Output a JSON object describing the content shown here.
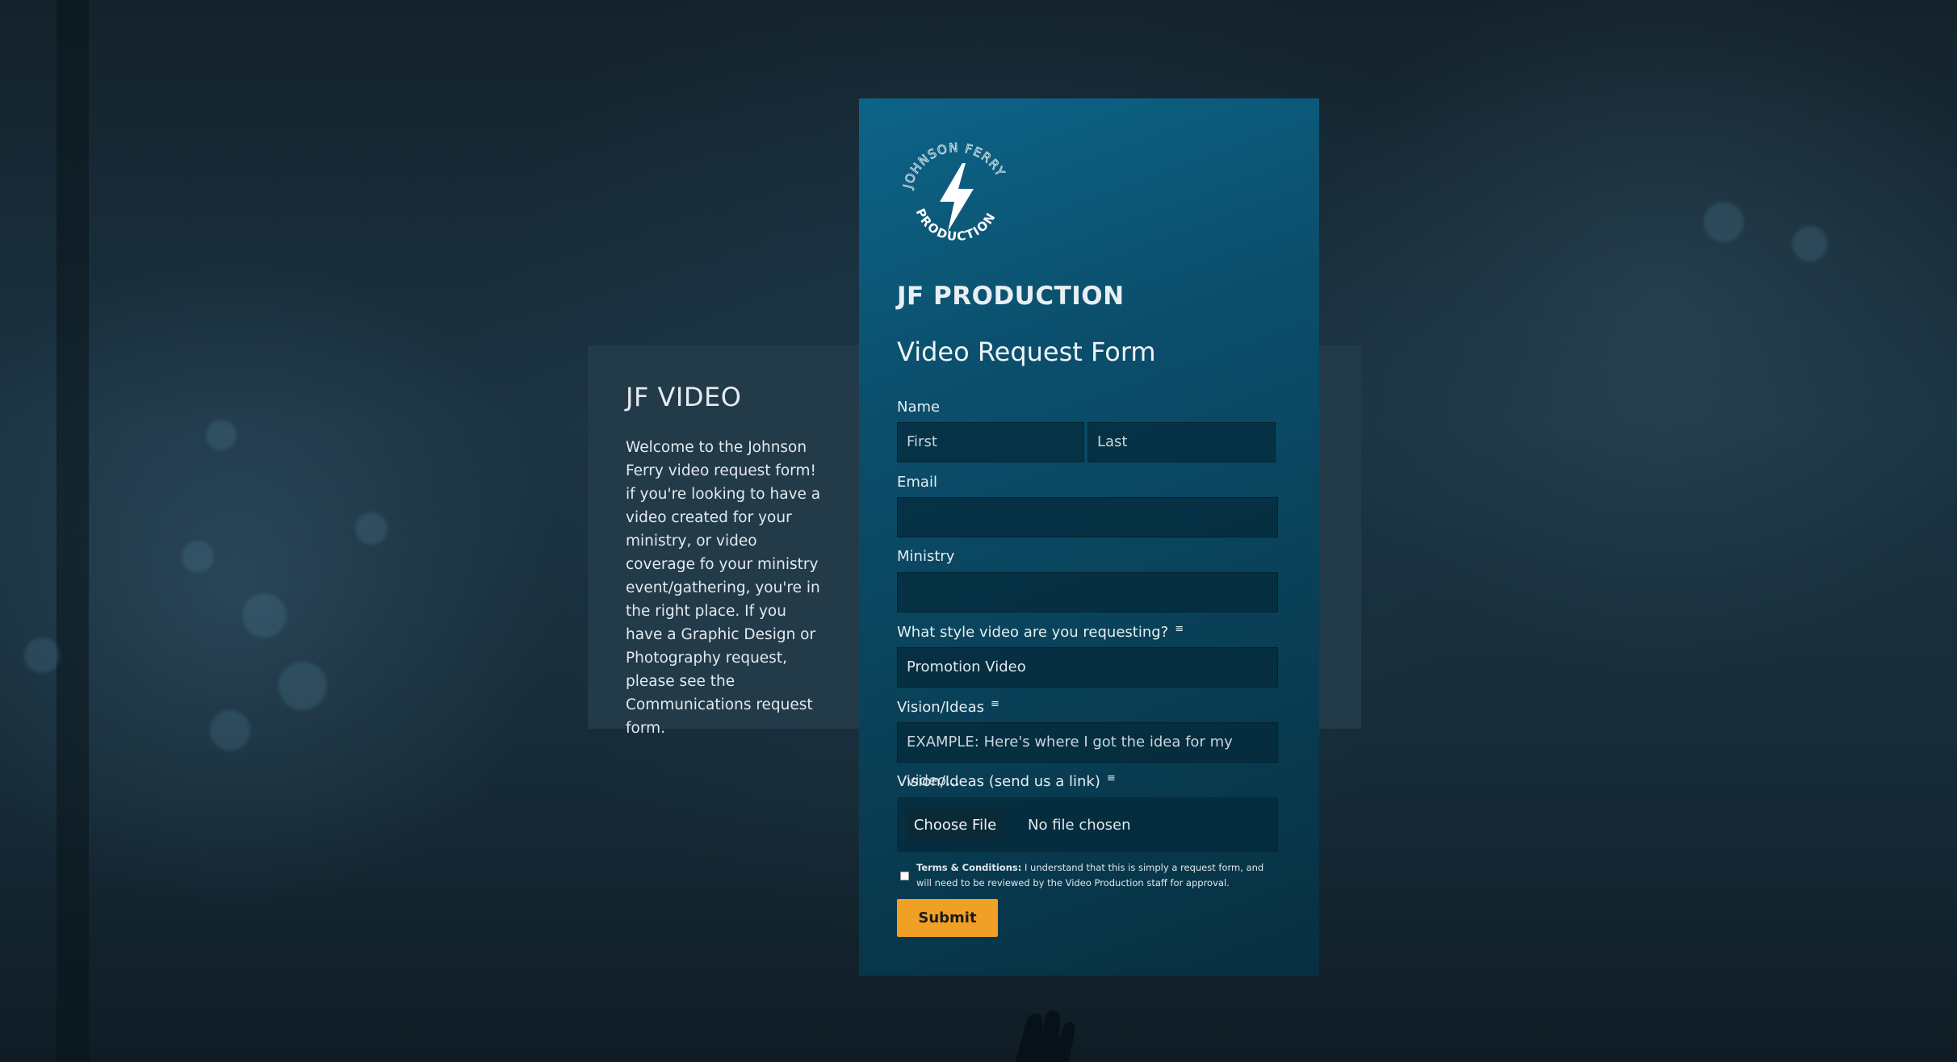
{
  "info_panel": {
    "title": "JF VIDEO",
    "description": "Welcome to the Johnson Ferry video request form! if you're looking to have a video created for your ministry, or video coverage fo your ministry event/gathering, you're in the right place. If you have a Graphic Design or Photography request, please see the Communications request form."
  },
  "logo": {
    "ring_text": "JOHNSON FERRY PRODUCTION",
    "icon": "lightning-bolt-icon"
  },
  "brand": "JF PRODUCTION",
  "form": {
    "title": "Video Request Form",
    "name_label": "Name",
    "first_placeholder": "First",
    "last_placeholder": "Last",
    "email_label": "Email",
    "ministry_label": "Ministry",
    "style_label": "What style video are you requesting?",
    "style_value": "Promotion Video",
    "vision_label": "Vision/Ideas",
    "vision_placeholder": "EXAMPLE: Here's where I got the idea for my video...",
    "vision_link_label": "Vision/Ideas (send us a link)",
    "choose_file_label": "Choose File",
    "no_file_text": "No file chosen",
    "terms_title": "Terms & Conditions:",
    "terms_text": "I understand that this is simply a request form, and will need to be reviewed by the Video Production staff for approval.",
    "submit_label": "Submit"
  },
  "colors": {
    "accent": "#f0a024",
    "card": "#0b4f6d",
    "panel": "#233a49"
  }
}
